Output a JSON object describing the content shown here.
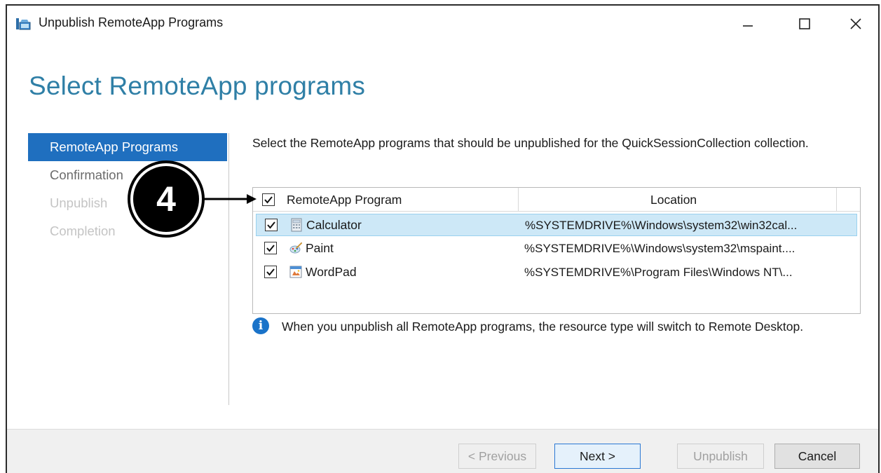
{
  "window": {
    "title": "Unpublish RemoteApp Programs",
    "controls": [
      "minimize",
      "maximize",
      "close"
    ]
  },
  "page": {
    "title": "Select RemoteApp programs"
  },
  "nav": {
    "items": [
      {
        "label": "RemoteApp Programs",
        "state": "active"
      },
      {
        "label": "Confirmation",
        "state": "enabled"
      },
      {
        "label": "Unpublish",
        "state": "disabled"
      },
      {
        "label": "Completion",
        "state": "disabled"
      }
    ]
  },
  "main": {
    "description": "Select the RemoteApp programs that should be unpublished for the QuickSessionCollection collection.",
    "grid": {
      "header_checked": true,
      "columns": [
        "RemoteApp Program",
        "Location"
      ],
      "rows": [
        {
          "name": "Calculator",
          "location": "%SYSTEMDRIVE%\\Windows\\system32\\win32cal...",
          "checked": true,
          "selected": true,
          "icon": "calculator-icon"
        },
        {
          "name": "Paint",
          "location": "%SYSTEMDRIVE%\\Windows\\system32\\mspaint....",
          "checked": true,
          "selected": false,
          "icon": "paint-icon"
        },
        {
          "name": "WordPad",
          "location": "%SYSTEMDRIVE%\\Program Files\\Windows NT\\...",
          "checked": true,
          "selected": false,
          "icon": "wordpad-icon"
        }
      ]
    },
    "info": {
      "icon": "info-icon",
      "glyph": "i",
      "text": "When you unpublish all RemoteApp programs, the resource type will switch to Remote Desktop."
    }
  },
  "footer": {
    "previous_label": "< Previous",
    "next_label": "Next >",
    "unpublish_label": "Unpublish",
    "cancel_label": "Cancel"
  },
  "callout": {
    "number": "4"
  },
  "colors": {
    "accent": "#1f6fbf",
    "title": "#2f7fa6",
    "selection": "#cde8f7"
  }
}
